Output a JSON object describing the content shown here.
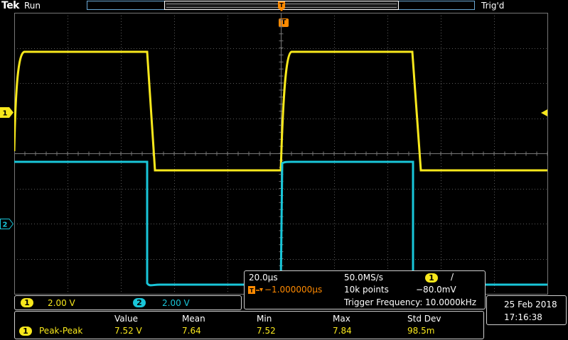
{
  "header": {
    "brand": "Tek",
    "status": "Run",
    "trigger_state": "Trig'd"
  },
  "markers": {
    "trigger": "T",
    "ch1": "1",
    "ch2": "2"
  },
  "colors": {
    "ch1": "#f8e81c",
    "ch2": "#19c6d9",
    "trigger": "#ff8a00",
    "grid": "#5a5a5a"
  },
  "channels": [
    {
      "id": "1",
      "scale": "2.00 V"
    },
    {
      "id": "2",
      "scale": "2.00 V"
    }
  ],
  "acquisition": {
    "time_div": "20.0µs",
    "sample_rate": "50.0MS/s",
    "trigger_channel": "1",
    "trigger_slope": "/",
    "trigger_delay": "−1.000000µs",
    "record_length": "10k points",
    "trigger_level": "−80.0mV",
    "trigger_frequency": "Trigger Frequency: 10.0000kHz"
  },
  "datetime": {
    "date": "25 Feb  2018",
    "time": "17:16:38"
  },
  "measurement": {
    "headers": [
      "Value",
      "Mean",
      "Min",
      "Max",
      "Std Dev"
    ],
    "channel": "1",
    "name": "Peak-Peak",
    "values": [
      "7.52 V",
      "7.64",
      "7.52",
      "7.84",
      "98.5m"
    ]
  }
}
